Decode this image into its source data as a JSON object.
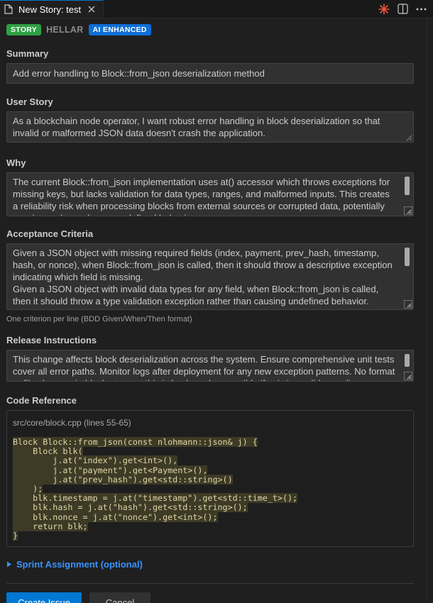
{
  "tab": {
    "title": "New Story: test",
    "close_icon": "close-icon",
    "actions": [
      "spark-icon",
      "split-editor-icon",
      "more-icon"
    ]
  },
  "badges": {
    "type": "STORY",
    "project": "HELLAR",
    "ai": "AI ENHANCED"
  },
  "summary": {
    "label": "Summary",
    "value": "Add error handling to Block::from_json deserialization method"
  },
  "user_story": {
    "label": "User Story",
    "value": "As a blockchain node operator, I want robust error handling in block deserialization so that invalid or malformed JSON data doesn't crash the application."
  },
  "why": {
    "label": "Why",
    "value": "The current Block::from_json implementation uses at() accessor which throws exceptions for missing keys, but lacks validation for data types, ranges, and malformed inputs. This creates a reliability risk when processing blocks from external sources or corrupted data, potentially causing node crashes or undefined behavior."
  },
  "acceptance": {
    "label": "Acceptance Criteria",
    "lines": [
      "Given a JSON object with missing required fields (index, payment, prev_hash, timestamp, hash, or nonce), when Block::from_json is called, then it should throw a descriptive exception indicating which field is missing.",
      "Given a JSON object with invalid data types for any field, when Block::from_json is called, then it should throw a type validation exception rather than causing undefined behavior."
    ],
    "hint": "One criterion per line (BDD Given/When/Then format)"
  },
  "release": {
    "label": "Release Instructions",
    "value": "This change affects block deserialization across the system. Ensure comprehensive unit tests cover all error paths. Monitor logs after deployment for any new exception patterns. No format or file changes in block storage; this is backward compatible if existing valid encoding..."
  },
  "code": {
    "label": "Code Reference",
    "ref": "src/core/block.cpp (lines 55-65)",
    "lines": [
      "Block Block::from_json(const nlohmann::json& j) {",
      "    Block blk(",
      "        j.at(\"index\").get<int>(),",
      "        j.at(\"payment\").get<Payment>(),",
      "        j.at(\"prev_hash\").get<std::string>()",
      "    );",
      "    blk.timestamp = j.at(\"timestamp\").get<std::time_t>();",
      "    blk.hash = j.at(\"hash\").get<std::string>();",
      "    blk.nonce = j.at(\"nonce\").get<int>();",
      "    return blk;",
      "}"
    ]
  },
  "sprint": {
    "label": "Sprint Assignment (optional)"
  },
  "actions": {
    "create": "Create Issue",
    "cancel": "Cancel"
  },
  "colors": {
    "accent": "#0078d4",
    "story_badge": "#2ea043",
    "ai_badge": "#0e6fd8",
    "link": "#3794ff"
  }
}
